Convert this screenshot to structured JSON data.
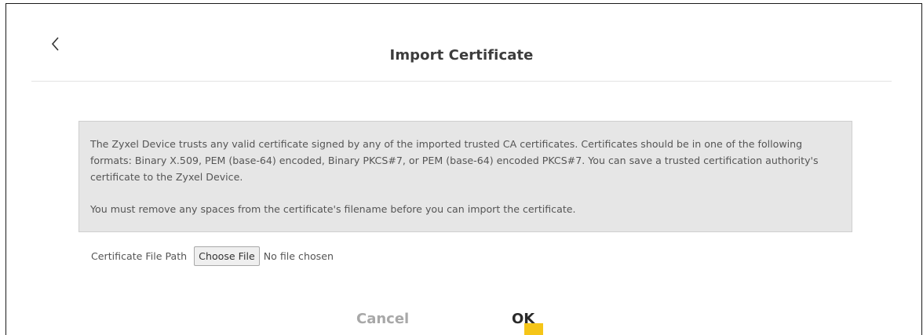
{
  "dialog": {
    "title": "Import Certificate",
    "back_icon": "chevron-left-icon"
  },
  "notice": {
    "paragraph1": "The Zyxel Device trusts any valid certificate signed by any of the imported trusted CA certificates. Certificates should be in one of the following formats: Binary X.509, PEM (base-64) encoded, Binary PKCS#7, or PEM (base-64) encoded PKCS#7. You can save a trusted certification authority's certificate to the Zyxel Device.",
    "paragraph2": "You must remove any spaces from the certificate's filename before you can import the certificate."
  },
  "file": {
    "label": "Certificate File Path",
    "button_label": "Choose File",
    "status": "No file chosen"
  },
  "actions": {
    "cancel_label": "Cancel",
    "ok_label": "OK"
  },
  "colors": {
    "ok_accent": "#f5c518",
    "notice_background": "#e6e6e6"
  }
}
